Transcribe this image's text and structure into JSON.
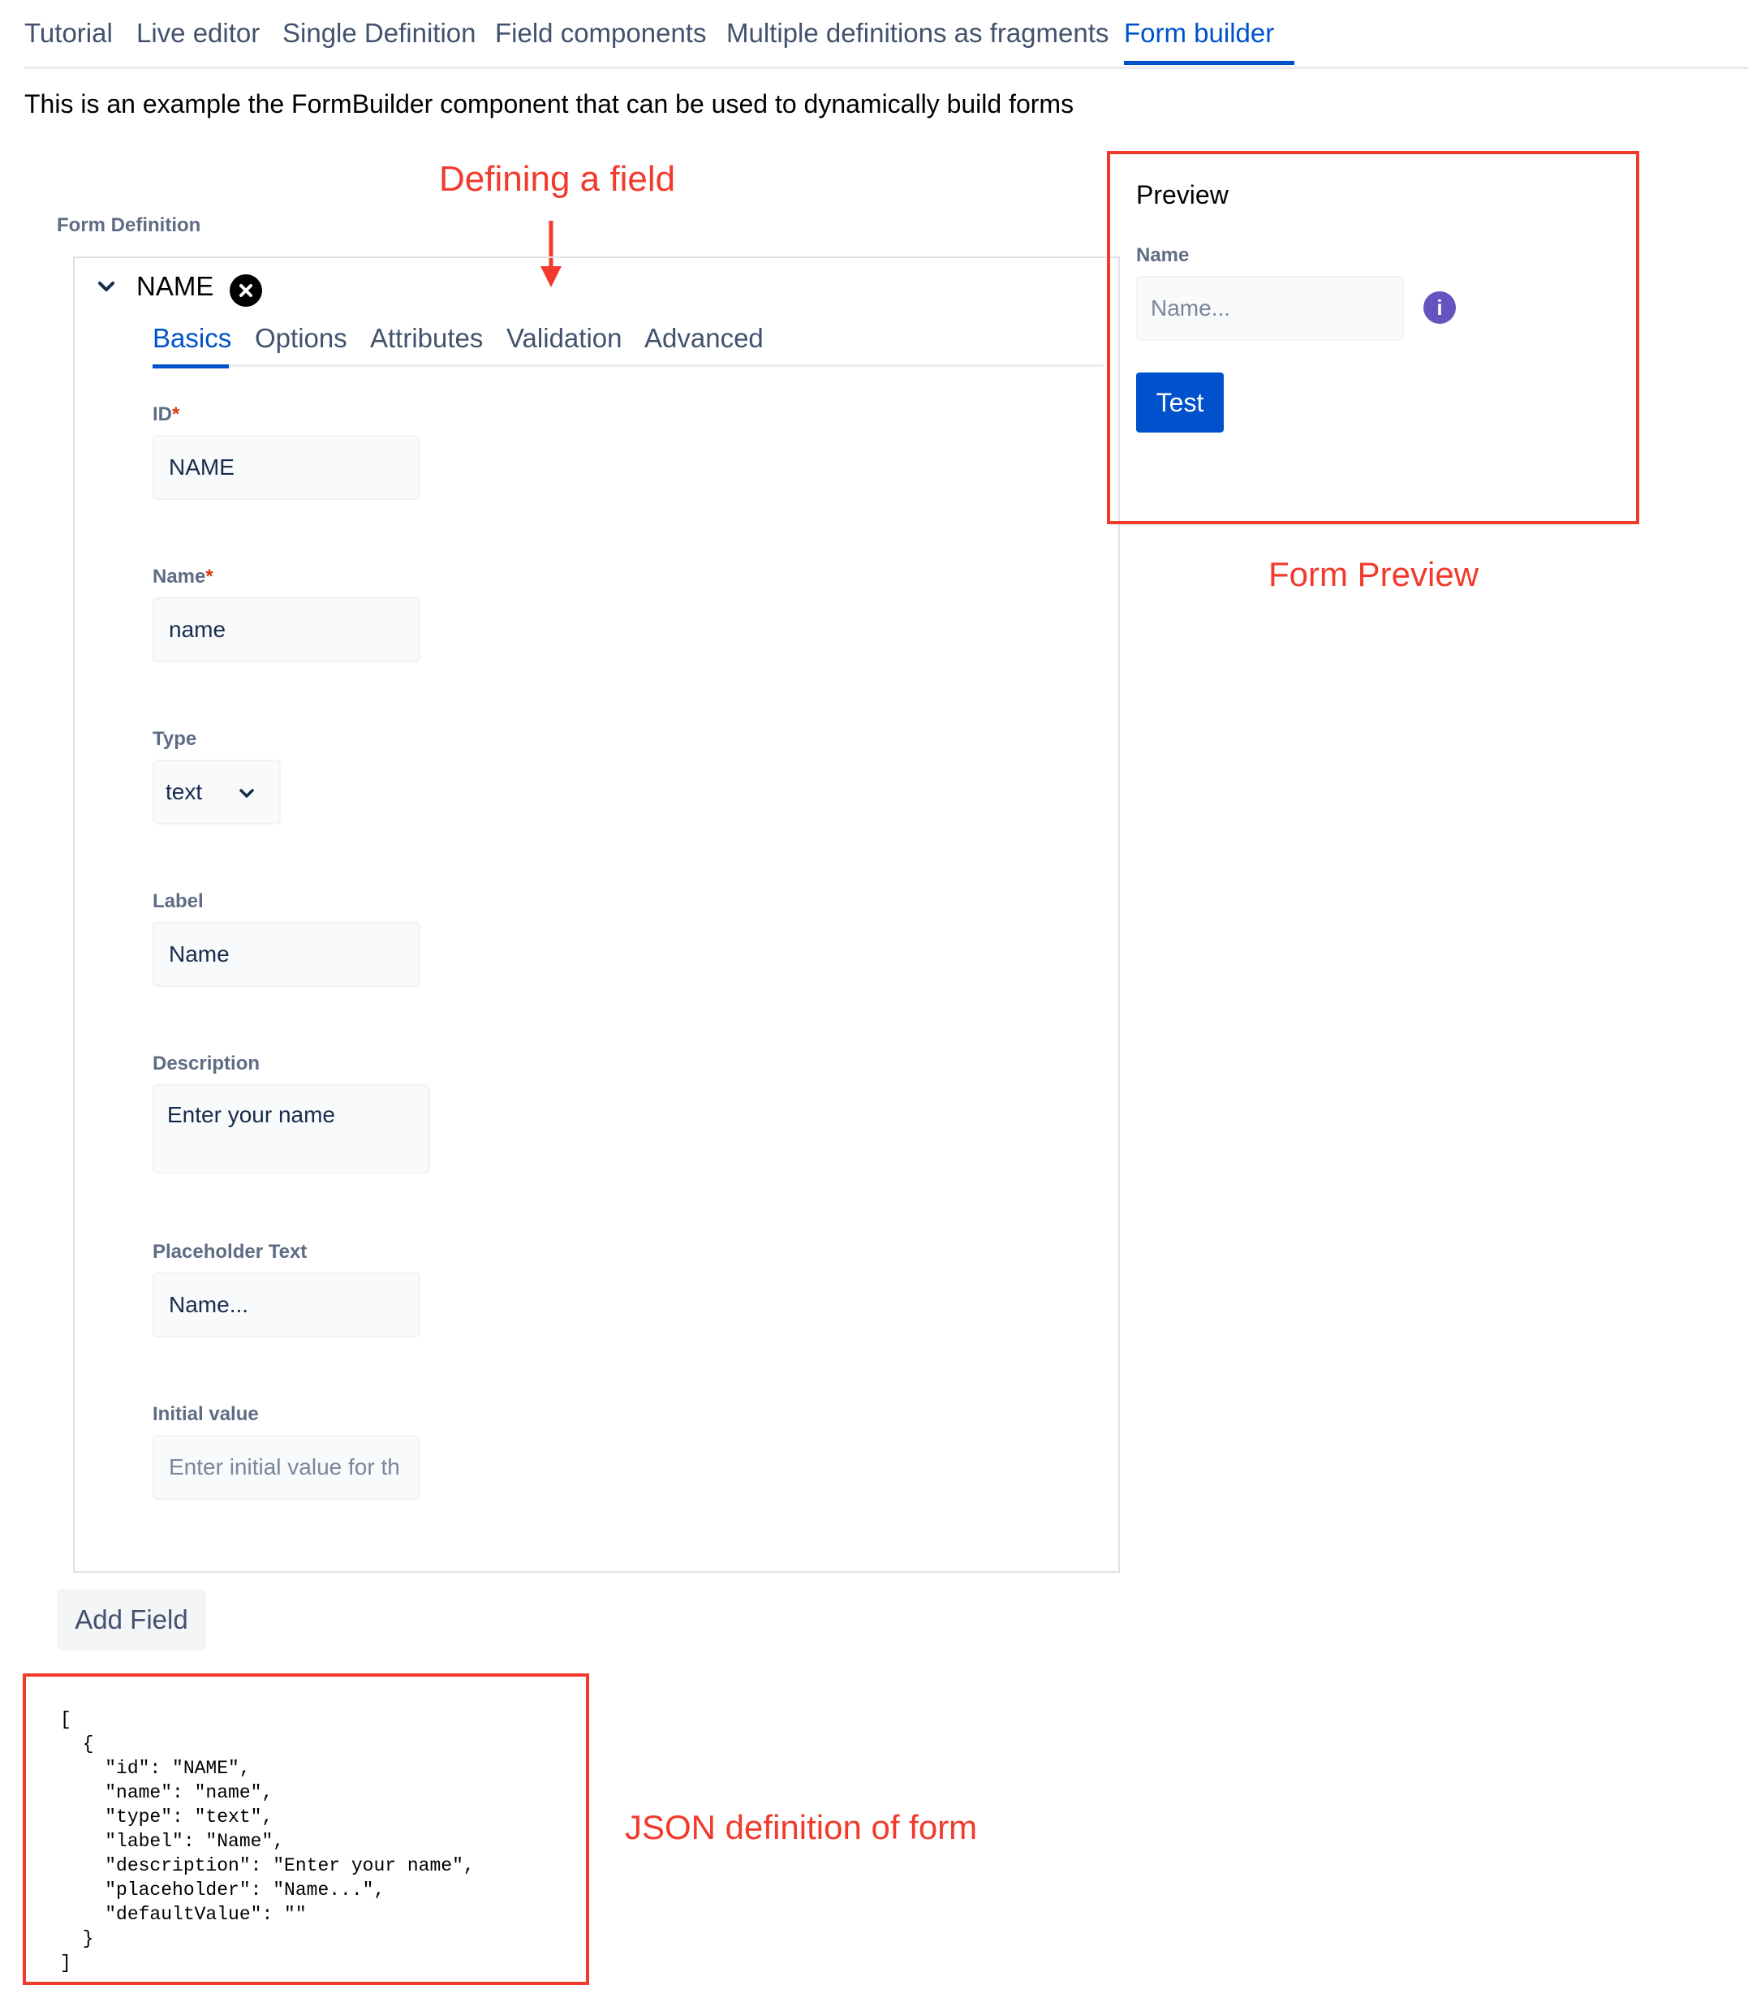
{
  "top_tabs": [
    {
      "label": "Tutorial"
    },
    {
      "label": "Live editor"
    },
    {
      "label": "Single Definition"
    },
    {
      "label": "Field components"
    },
    {
      "label": "Multiple definitions as fragments"
    },
    {
      "label": "Form builder"
    }
  ],
  "intro_text": "This is an example the FormBuilder component that can be used to dynamically build forms",
  "annotations": {
    "defining_field": "Defining a field",
    "form_preview": "Form Preview",
    "json_definition": "JSON definition of form"
  },
  "form_definition": {
    "label": "Form Definition",
    "field_title": "NAME",
    "tabs": [
      {
        "label": "Basics"
      },
      {
        "label": "Options"
      },
      {
        "label": "Attributes"
      },
      {
        "label": "Validation"
      },
      {
        "label": "Advanced"
      }
    ],
    "required_marker": "*",
    "fields": {
      "id": {
        "label": "ID",
        "value": "NAME"
      },
      "name": {
        "label": "Name",
        "value": "name"
      },
      "type": {
        "label": "Type",
        "value": "text"
      },
      "label": {
        "label": "Label",
        "value": "Name"
      },
      "description": {
        "label": "Description",
        "value": "Enter your name"
      },
      "placeholder": {
        "label": "Placeholder Text",
        "value": "Name..."
      },
      "initial_value": {
        "label": "Initial value",
        "placeholder": "Enter initial value for th"
      }
    },
    "add_field_label": "Add Field"
  },
  "preview": {
    "title": "Preview",
    "field_label": "Name",
    "field_placeholder": "Name...",
    "info_glyph": "i",
    "test_button": "Test"
  },
  "json_output": "[\n  {\n    \"id\": \"NAME\",\n    \"name\": \"name\",\n    \"type\": \"text\",\n    \"label\": \"Name\",\n    \"description\": \"Enter your name\",\n    \"placeholder\": \"Name...\",\n    \"defaultValue\": \"\"\n  }\n]",
  "colors": {
    "accent": "#0052cc",
    "annotation": "#f23a2c",
    "info": "#6554c0"
  }
}
